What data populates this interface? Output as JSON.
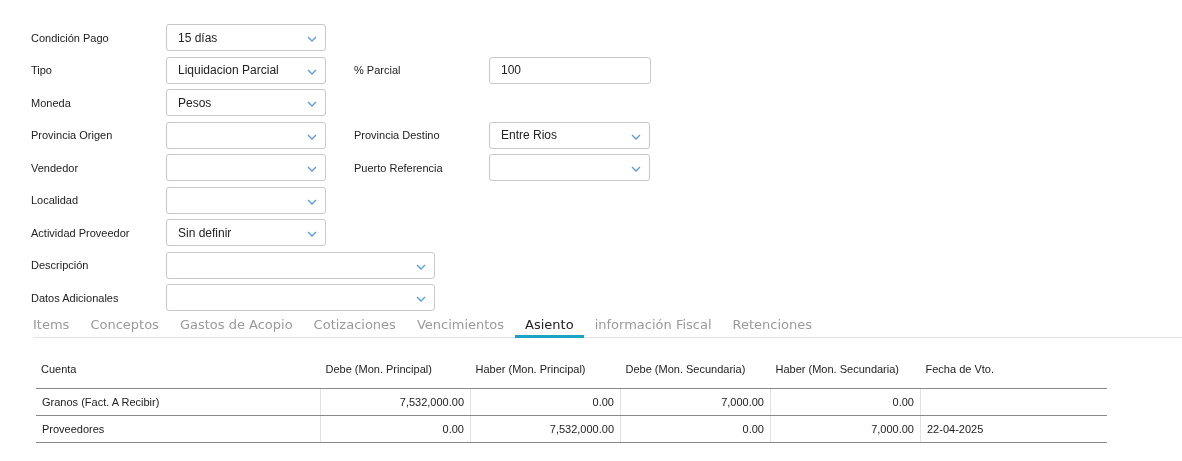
{
  "form": {
    "rows": [
      {
        "left": {
          "label": "Condición Pago",
          "kind": "select",
          "value": "15 días"
        }
      },
      {
        "left": {
          "label": "Tipo",
          "kind": "select",
          "value": "Liquidacion Parcial"
        },
        "right": {
          "label": "% Parcial",
          "kind": "text",
          "value": "100"
        }
      },
      {
        "left": {
          "label": "Moneda",
          "kind": "select",
          "value": "Pesos"
        }
      },
      {
        "left": {
          "label": "Provincia Origen",
          "kind": "select"
        },
        "right": {
          "label": "Provincia Destino",
          "kind": "select",
          "value": "Entre Rios"
        }
      },
      {
        "left": {
          "label": "Vendedor",
          "kind": "select"
        },
        "right": {
          "label": "Puerto Referencia",
          "kind": "select"
        }
      },
      {
        "left": {
          "label": "Localidad",
          "kind": "select"
        }
      },
      {
        "left": {
          "label": "Actividad Proveedor",
          "kind": "select",
          "value": "Sin definir"
        }
      }
    ],
    "long_fields": [
      {
        "label": "Descripción"
      },
      {
        "label": "Datos Adicionales"
      }
    ]
  },
  "tabs": [
    {
      "label": "Items",
      "selected": false
    },
    {
      "label": "Conceptos",
      "selected": false
    },
    {
      "label": "Gastos de Acopio",
      "selected": false
    },
    {
      "label": "Cotizaciones",
      "selected": false
    },
    {
      "label": "Vencimientos",
      "selected": false
    },
    {
      "label": "Asiento",
      "selected": true
    },
    {
      "label": "información Fiscal",
      "selected": false
    },
    {
      "label": "Retenciones",
      "selected": false
    }
  ],
  "table": {
    "columns": [
      "Cuenta",
      "Debe (Mon. Principal)",
      "Haber (Mon. Principal)",
      "Debe (Mon. Secundaria)",
      "Haber (Mon. Secundaria)",
      "Fecha de Vto."
    ],
    "rows": [
      [
        "Granos (Fact. A Recibir)",
        "7,532,000.00",
        "0.00",
        "7,000.00",
        "0.00",
        ""
      ],
      [
        "Proveedores",
        "0.00",
        "7,532,000.00",
        "0.00",
        "7,000.00",
        "22-04-2025"
      ]
    ]
  }
}
